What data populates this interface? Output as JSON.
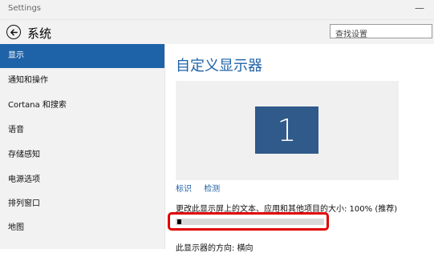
{
  "window": {
    "title": "Settings",
    "minimize_symbol": "—"
  },
  "header": {
    "title": "系统",
    "back_icon": "back-arrow-circle-icon"
  },
  "search": {
    "placeholder": "查找设置"
  },
  "sidebar": {
    "items": [
      {
        "label": "显示",
        "active": true
      },
      {
        "label": "通知和操作",
        "active": false
      },
      {
        "label": "Cortana 和搜索",
        "active": false
      },
      {
        "label": "语音",
        "active": false
      },
      {
        "label": "存储感知",
        "active": false
      },
      {
        "label": "电源选项",
        "active": false
      },
      {
        "label": "排列窗口",
        "active": false
      },
      {
        "label": "地图",
        "active": false
      }
    ]
  },
  "main": {
    "title": "自定义显示器",
    "monitor_number": "1",
    "links": {
      "identify": "标识",
      "detect": "检测"
    },
    "scale_label": "更改此显示屏上的文本、应用和其他项目的大小: 100% (推荐)",
    "scale_level": 0,
    "next_heading": "此显示器的方向: 横向"
  },
  "colors": {
    "accent": "#1e62a8",
    "highlight_outline": "#e00000",
    "monitor": "#2f5a8a"
  }
}
